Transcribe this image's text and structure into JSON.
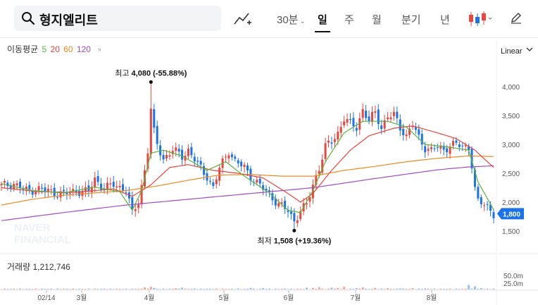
{
  "toolbar": {
    "stock_name": "형지엘리트",
    "tabs": [
      {
        "label": "30분",
        "active": false,
        "has_chevron": true
      },
      {
        "label": "일",
        "active": true
      },
      {
        "label": "주",
        "active": false
      },
      {
        "label": "월",
        "active": false
      },
      {
        "label": "분기",
        "active": false
      },
      {
        "label": "년",
        "active": false
      }
    ],
    "icons": [
      "search-icon",
      "draw-line-icon",
      "candle-type-icon",
      "pen-icon"
    ]
  },
  "indicator_legend": {
    "label": "이동평균",
    "periods": [
      {
        "value": "5",
        "color": "#5bb33c"
      },
      {
        "value": "20",
        "color": "#e8463e"
      },
      {
        "value": "60",
        "color": "#f08a1e"
      },
      {
        "value": "120",
        "color": "#a24cc2"
      }
    ],
    "close_glyph": "×"
  },
  "scale": {
    "label": "Linear"
  },
  "volume": {
    "label": "거래량",
    "value": "1,212,746",
    "ticks": [
      "50.0m",
      "25.0m"
    ]
  },
  "watermark": [
    "NAVER",
    "FINANCIAL"
  ],
  "colors": {
    "up": "#e8463e",
    "down": "#1a73e8",
    "last_price_tag": "#1a73e8"
  },
  "chart_data": {
    "type": "candlestick",
    "scale": "linear",
    "ylim": [
      1300,
      4300
    ],
    "yticks": [
      4000,
      3500,
      3000,
      2500,
      2000,
      1500
    ],
    "ytick_labels": [
      "4,000",
      "3,500",
      "3,000",
      "2,500",
      "2,000",
      "1,500"
    ],
    "xtick_labels": [
      "02/14",
      "3월",
      "4월",
      "5월",
      "6월",
      "7월",
      "8월"
    ],
    "last_price": 1800,
    "last_price_label": "1,800",
    "high": {
      "prefix": "최고",
      "value": 4080,
      "text": "4,080 (-55.88%)"
    },
    "low": {
      "prefix": "최저",
      "value": 1508,
      "text": "1,508 (+19.36%)"
    },
    "close_path": [
      [
        0,
        2280
      ],
      [
        4,
        2320
      ],
      [
        8,
        2200
      ],
      [
        12,
        2230
      ],
      [
        16,
        2180
      ],
      [
        20,
        2140
      ],
      [
        24,
        2200
      ],
      [
        28,
        2180
      ],
      [
        30,
        2400
      ],
      [
        33,
        2240
      ],
      [
        36,
        2300
      ],
      [
        40,
        2220
      ],
      [
        42,
        1800
      ],
      [
        44,
        2000
      ],
      [
        46,
        2560
      ],
      [
        47,
        2900
      ],
      [
        48,
        3600
      ],
      [
        49,
        3200
      ],
      [
        50,
        3000
      ],
      [
        52,
        2750
      ],
      [
        55,
        2900
      ],
      [
        58,
        2800
      ],
      [
        60,
        2900
      ],
      [
        63,
        2650
      ],
      [
        66,
        2450
      ],
      [
        68,
        2250
      ],
      [
        70,
        2580
      ],
      [
        73,
        2900
      ],
      [
        75,
        2700
      ],
      [
        78,
        2600
      ],
      [
        80,
        2450
      ],
      [
        83,
        2280
      ],
      [
        86,
        2140
      ],
      [
        89,
        1960
      ],
      [
        92,
        1850
      ],
      [
        94,
        1680
      ],
      [
        96,
        1850
      ],
      [
        98,
        1950
      ],
      [
        100,
        2300
      ],
      [
        102,
        2600
      ],
      [
        104,
        2950
      ],
      [
        106,
        3050
      ],
      [
        108,
        3200
      ],
      [
        110,
        3450
      ],
      [
        112,
        3350
      ],
      [
        114,
        3300
      ],
      [
        116,
        3600
      ],
      [
        118,
        3400
      ],
      [
        120,
        3550
      ],
      [
        122,
        3300
      ],
      [
        124,
        3480
      ],
      [
        126,
        3500
      ],
      [
        128,
        3300
      ],
      [
        130,
        3150
      ],
      [
        132,
        3350
      ],
      [
        134,
        3100
      ],
      [
        136,
        2950
      ],
      [
        138,
        2900
      ],
      [
        140,
        2950
      ],
      [
        142,
        2900
      ],
      [
        144,
        3000
      ],
      [
        146,
        3000
      ],
      [
        148,
        2950
      ],
      [
        150,
        2960
      ],
      [
        151,
        2650
      ],
      [
        152,
        2220
      ],
      [
        153,
        2000
      ],
      [
        155,
        1960
      ],
      [
        157,
        1880
      ],
      [
        158,
        1800
      ]
    ],
    "ma_anchors": {
      "ma5": [
        [
          0,
          2320
        ],
        [
          10,
          2200
        ],
        [
          20,
          2160
        ],
        [
          30,
          2260
        ],
        [
          38,
          2180
        ],
        [
          42,
          1860
        ],
        [
          45,
          2200
        ],
        [
          48,
          2850
        ],
        [
          52,
          2900
        ],
        [
          58,
          2800
        ],
        [
          66,
          2550
        ],
        [
          72,
          2700
        ],
        [
          78,
          2450
        ],
        [
          86,
          2160
        ],
        [
          92,
          1860
        ],
        [
          96,
          1820
        ],
        [
          100,
          2200
        ],
        [
          104,
          2700
        ],
        [
          110,
          3200
        ],
        [
          116,
          3400
        ],
        [
          124,
          3400
        ],
        [
          130,
          3300
        ],
        [
          136,
          3000
        ],
        [
          144,
          2950
        ],
        [
          150,
          2900
        ],
        [
          153,
          2350
        ],
        [
          158,
          1870
        ]
      ],
      "ma20": [
        [
          0,
          2250
        ],
        [
          12,
          2180
        ],
        [
          24,
          2170
        ],
        [
          36,
          2230
        ],
        [
          42,
          2100
        ],
        [
          48,
          2300
        ],
        [
          54,
          2600
        ],
        [
          60,
          2650
        ],
        [
          68,
          2550
        ],
        [
          76,
          2500
        ],
        [
          84,
          2420
        ],
        [
          92,
          2150
        ],
        [
          96,
          2000
        ],
        [
          100,
          2150
        ],
        [
          106,
          2550
        ],
        [
          112,
          2900
        ],
        [
          118,
          3150
        ],
        [
          126,
          3280
        ],
        [
          132,
          3320
        ],
        [
          140,
          3200
        ],
        [
          146,
          3100
        ],
        [
          152,
          2900
        ],
        [
          158,
          2600
        ]
      ],
      "ma60": [
        [
          0,
          1950
        ],
        [
          10,
          2050
        ],
        [
          20,
          2120
        ],
        [
          30,
          2160
        ],
        [
          40,
          2200
        ],
        [
          50,
          2280
        ],
        [
          60,
          2380
        ],
        [
          70,
          2470
        ],
        [
          80,
          2480
        ],
        [
          90,
          2450
        ],
        [
          100,
          2450
        ],
        [
          110,
          2550
        ],
        [
          120,
          2620
        ],
        [
          130,
          2700
        ],
        [
          140,
          2760
        ],
        [
          150,
          2800
        ],
        [
          158,
          2790
        ]
      ],
      "ma120": [
        [
          0,
          1680
        ],
        [
          20,
          1820
        ],
        [
          40,
          1950
        ],
        [
          60,
          2050
        ],
        [
          80,
          2150
        ],
        [
          100,
          2250
        ],
        [
          120,
          2410
        ],
        [
          140,
          2560
        ],
        [
          150,
          2610
        ],
        [
          158,
          2630
        ]
      ]
    },
    "volume_ylim": [
      0,
      60
    ],
    "volume_unit": "m",
    "volume_spikes": [
      [
        46,
        8
      ],
      [
        48,
        10
      ],
      [
        49,
        6
      ],
      [
        56,
        5
      ],
      [
        58,
        7
      ],
      [
        62,
        4
      ],
      [
        76,
        4
      ],
      [
        80,
        6
      ],
      [
        84,
        5
      ],
      [
        98,
        7
      ],
      [
        100,
        6
      ],
      [
        102,
        9
      ],
      [
        106,
        7
      ],
      [
        108,
        6
      ],
      [
        110,
        10
      ],
      [
        114,
        5
      ],
      [
        116,
        8
      ],
      [
        120,
        6
      ],
      [
        124,
        5
      ],
      [
        128,
        4
      ],
      [
        132,
        5
      ],
      [
        136,
        4
      ],
      [
        150,
        17
      ],
      [
        152,
        12
      ],
      [
        154,
        5
      ]
    ]
  }
}
